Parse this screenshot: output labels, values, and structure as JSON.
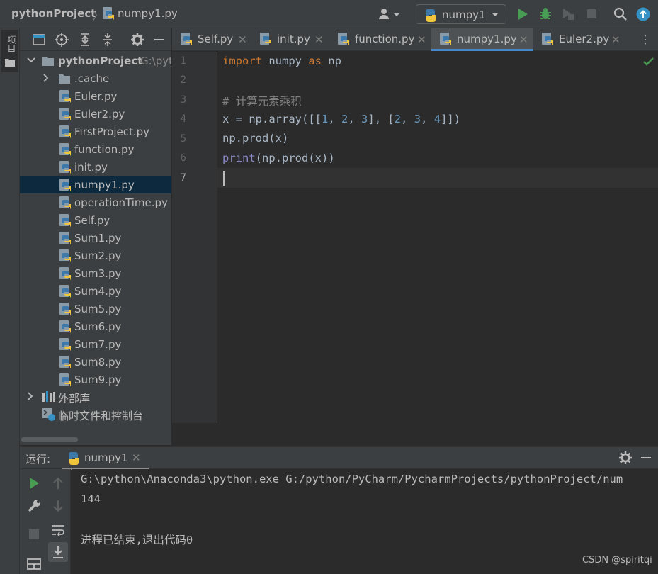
{
  "breadcrumb": {
    "project": "pythonProject",
    "file": "numpy1.py"
  },
  "run_config": {
    "label": "numpy1"
  },
  "left_strip": {
    "project_tab_label": "项目"
  },
  "project_tree": {
    "root": {
      "label": "pythonProject",
      "path_hint": "G:\\pyt"
    },
    "items": [
      {
        "label": ".cache",
        "type": "folder"
      },
      {
        "label": "Euler.py",
        "type": "py"
      },
      {
        "label": "Euler2.py",
        "type": "py"
      },
      {
        "label": "FirstProject.py",
        "type": "py"
      },
      {
        "label": "function.py",
        "type": "py"
      },
      {
        "label": "init.py",
        "type": "py"
      },
      {
        "label": "numpy1.py",
        "type": "py",
        "selected": true
      },
      {
        "label": "operationTime.py",
        "type": "py"
      },
      {
        "label": "Self.py",
        "type": "py"
      },
      {
        "label": "Sum1.py",
        "type": "py"
      },
      {
        "label": "Sum2.py",
        "type": "py"
      },
      {
        "label": "Sum3.py",
        "type": "py"
      },
      {
        "label": "Sum4.py",
        "type": "py"
      },
      {
        "label": "Sum5.py",
        "type": "py"
      },
      {
        "label": "Sum6.py",
        "type": "py"
      },
      {
        "label": "Sum7.py",
        "type": "py"
      },
      {
        "label": "Sum8.py",
        "type": "py"
      },
      {
        "label": "Sum9.py",
        "type": "py"
      }
    ],
    "external_libraries": "外部库",
    "scratches": "临时文件和控制台"
  },
  "tabs": [
    {
      "label": "Self.py"
    },
    {
      "label": "init.py"
    },
    {
      "label": "function.py"
    },
    {
      "label": "numpy1.py",
      "active": true
    },
    {
      "label": "Euler2.py"
    }
  ],
  "editor": {
    "line_numbers": [
      "1",
      "2",
      "3",
      "4",
      "5",
      "6",
      "7"
    ],
    "current_line": "7",
    "code": {
      "l1_import": "import",
      "l1_module": " numpy ",
      "l1_as": "as",
      "l1_alias": " np",
      "l3_comment": "# 计算元素乘积",
      "l4_pre": "x = np.array([[",
      "l4_n1": "1",
      "l4_s1": ", ",
      "l4_n2": "2",
      "l4_s2": ", ",
      "l4_n3": "3",
      "l4_s3": "], [",
      "l4_n4": "2",
      "l4_s4": ", ",
      "l4_n5": "3",
      "l4_s5": ", ",
      "l4_n6": "4",
      "l4_post": "]])",
      "l5": "np.prod(x)",
      "l6_builtin": "print",
      "l6_rest": "(np.prod(x))"
    }
  },
  "run_panel": {
    "title": "运行:",
    "tab_label": "numpy1",
    "console": {
      "command": "G:\\python\\Anaconda3\\python.exe G:/python/PyCharm/PycharmProjects/pythonProject/num",
      "output": "144",
      "exit_message": "进程已结束,退出代码0"
    }
  },
  "watermark": "CSDN @spiritqi",
  "colors": {
    "keyword": "#cc7832",
    "comment": "#808080",
    "number": "#6897bb",
    "builtin": "#8888c6",
    "run_green": "#499c54",
    "accent_blue": "#4a88c7"
  }
}
